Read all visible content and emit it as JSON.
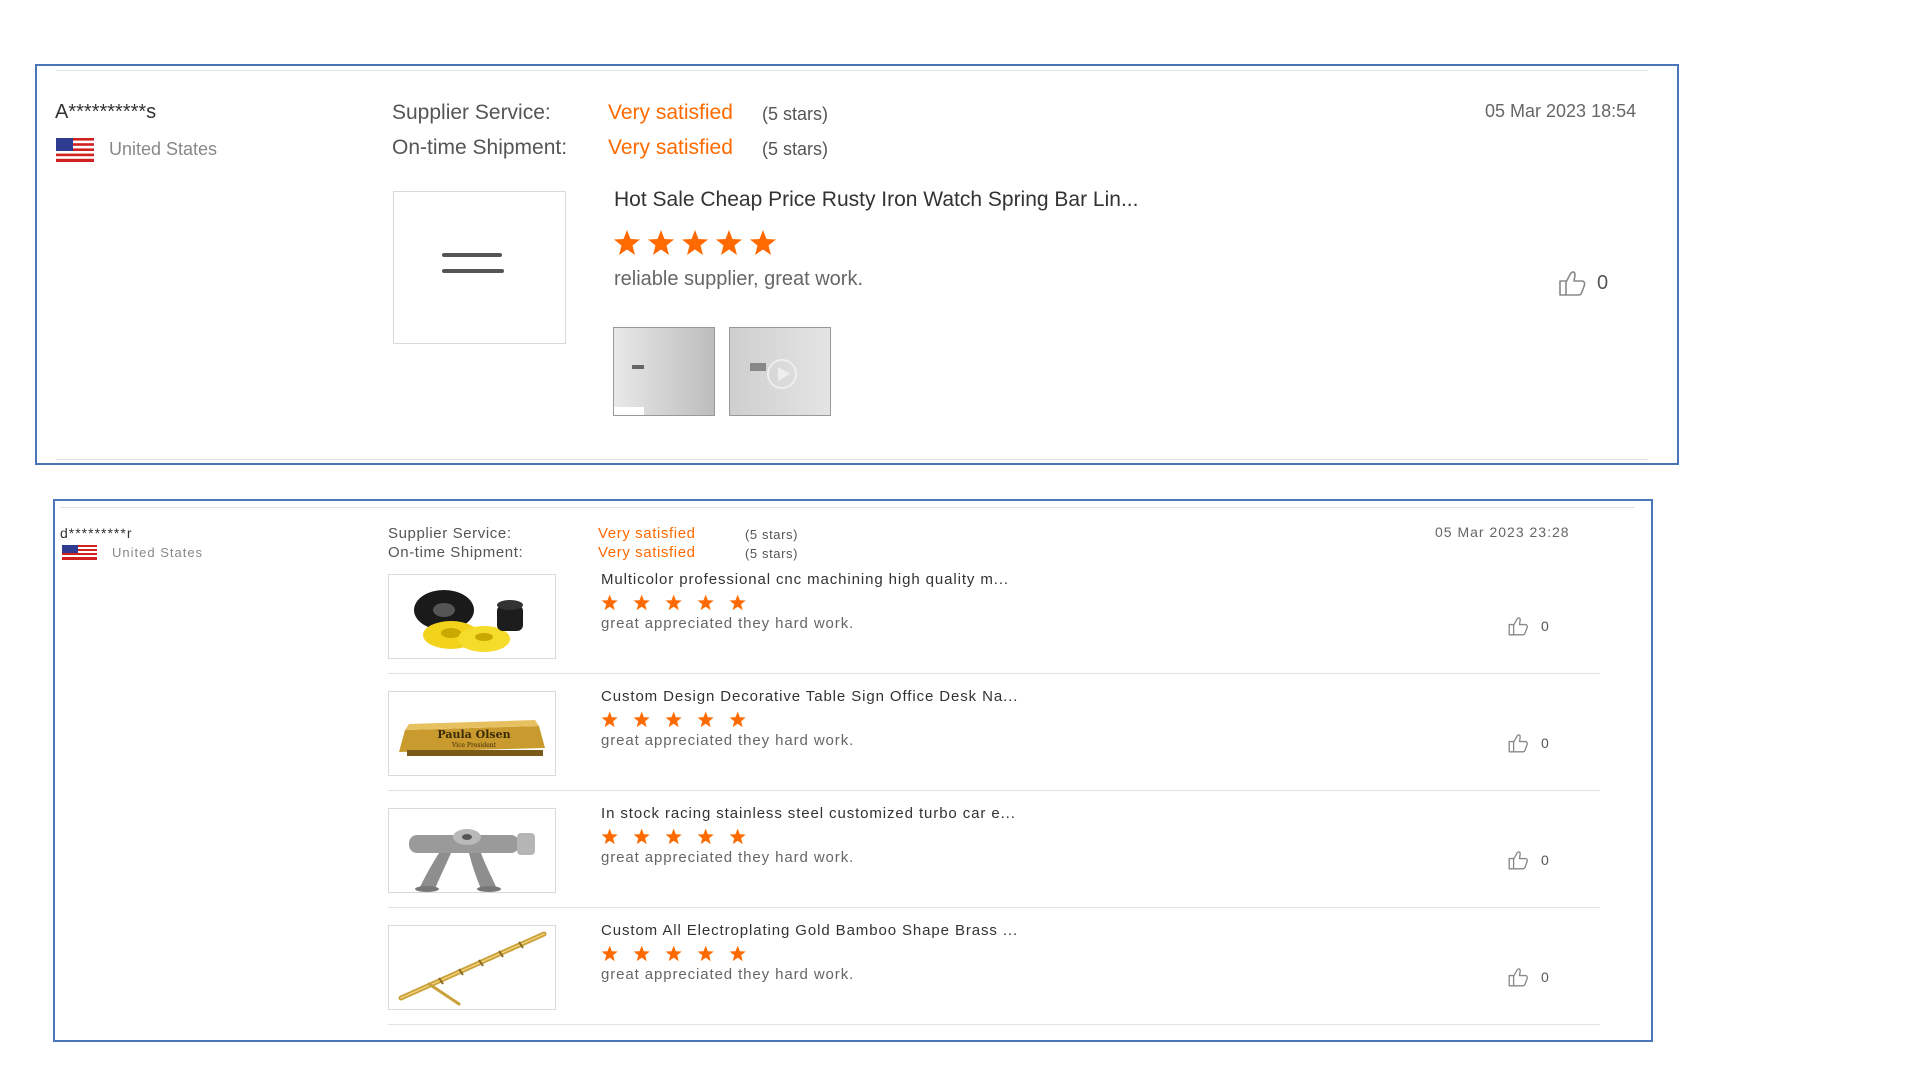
{
  "reviews": [
    {
      "buyer": "A**********s",
      "country": "United States",
      "date": "05 Mar 2023 18:54",
      "ratings": [
        {
          "label": "Supplier Service:",
          "value": "Very satisfied",
          "note": "(5 stars)"
        },
        {
          "label": "On-time Shipment:",
          "value": "Very satisfied",
          "note": "(5 stars)"
        }
      ],
      "products": [
        {
          "title": "Hot Sale Cheap Price Rusty Iron Watch Spring Bar Lin...",
          "stars": 5,
          "comment": "reliable supplier, great work.",
          "likes": "0",
          "image_icon": "spring-bar-icon",
          "media": [
            "photo-thumbnail",
            "video-thumbnail"
          ]
        }
      ]
    },
    {
      "buyer": "d*********r",
      "country": "United States",
      "date": "05 Mar 2023 23:28",
      "ratings": [
        {
          "label": "Supplier Service:",
          "value": "Very satisfied",
          "note": "(5 stars)"
        },
        {
          "label": "On-time Shipment:",
          "value": "Very satisfied",
          "note": "(5 stars)"
        }
      ],
      "products": [
        {
          "title": "Multicolor professional cnc machining high quality m...",
          "stars": 5,
          "comment": "great appreciated they hard work.",
          "likes": "0",
          "image_icon": "rubber-rings-icon"
        },
        {
          "title": "Custom Design Decorative Table Sign Office Desk Na...",
          "stars": 5,
          "comment": "great appreciated they hard work.",
          "likes": "0",
          "image_icon": "name-plate-icon",
          "image_text_1": "Paula Olsen",
          "image_text_2": "Vice President"
        },
        {
          "title": "In stock racing stainless steel customized turbo car e...",
          "stars": 5,
          "comment": "great appreciated they hard work.",
          "likes": "0",
          "image_icon": "exhaust-manifold-icon"
        },
        {
          "title": "Custom All Electroplating Gold Bamboo Shape Brass ...",
          "stars": 5,
          "comment": "great appreciated they hard work.",
          "likes": "0",
          "image_icon": "brass-pen-icon"
        }
      ]
    }
  ],
  "colors": {
    "accent": "#ff6a00",
    "border": "#4a76b8",
    "muted": "#888888"
  }
}
